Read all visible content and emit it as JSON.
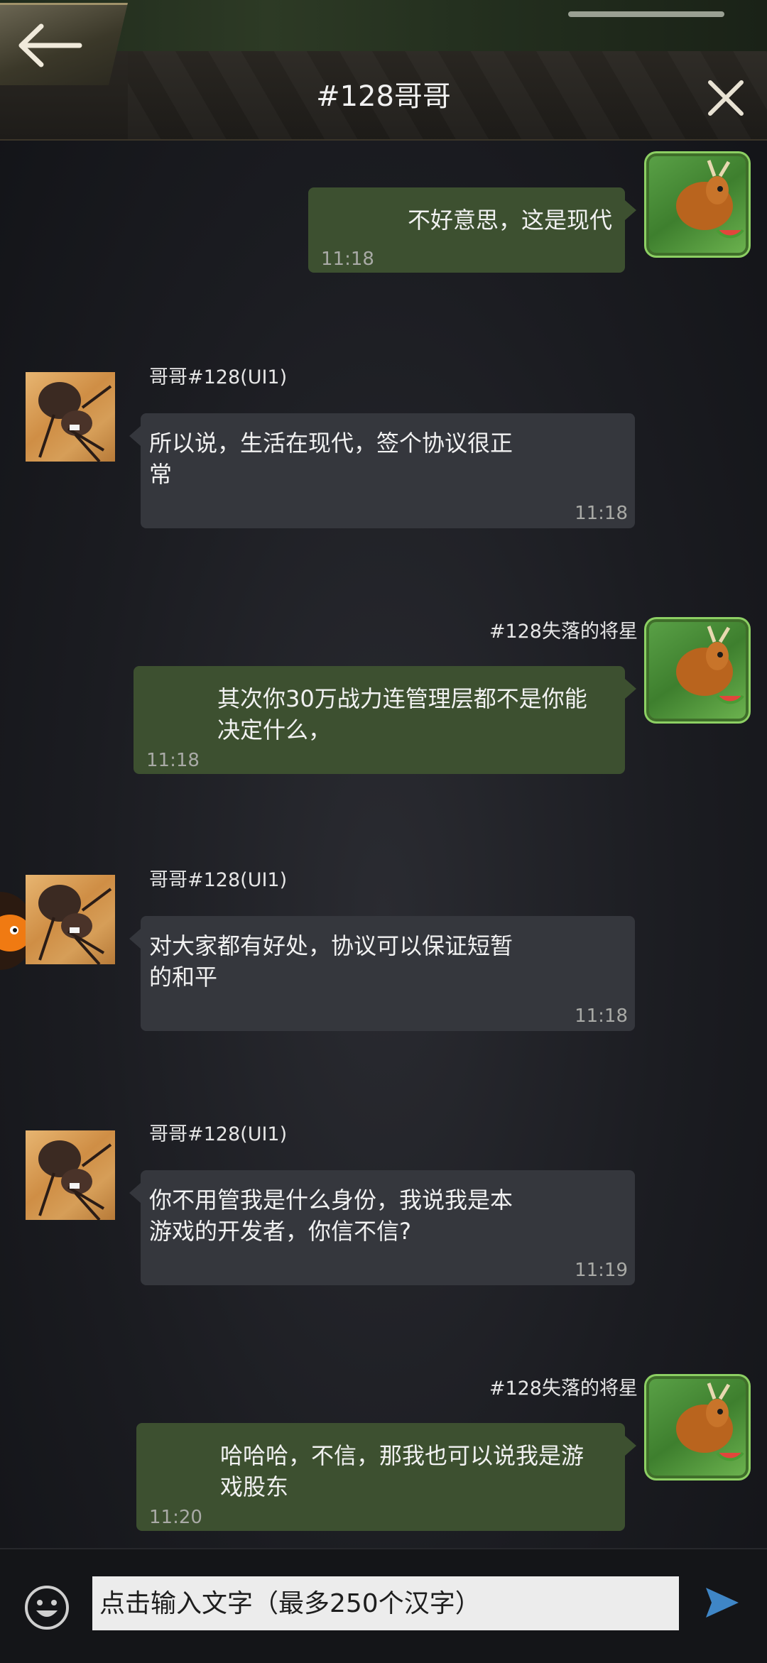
{
  "header": {
    "title": "#128哥哥"
  },
  "messages": [
    {
      "side": "right",
      "text": "不好意思，这是现代",
      "time": "11:18"
    },
    {
      "side": "left",
      "nick": "哥哥#128(UI1)",
      "text": "所以说，生活在现代，签个协议很正\n常",
      "time": "11:18"
    },
    {
      "side": "right",
      "nick": "#128失落的将星",
      "text": "其次你30万战力连管理层都不是你能\n决定什么，",
      "time": "11:18"
    },
    {
      "side": "left",
      "nick": "哥哥#128(UI1)",
      "text": "对大家都有好处，协议可以保证短暂\n的和平",
      "time": "11:18"
    },
    {
      "side": "left",
      "nick": "哥哥#128(UI1)",
      "text": "你不用管我是什么身份，我说我是本\n游戏的开发者，你信不信?",
      "time": "11:19"
    },
    {
      "side": "right",
      "nick": "#128失落的将星",
      "text": "哈哈哈，不信，那我也可以说我是游\n戏股东",
      "time": "11:20"
    }
  ],
  "input": {
    "placeholder": "点击输入文字（最多250个汉字）"
  },
  "icons": {
    "back": "back-arrow-icon",
    "close": "close-icon",
    "emoji": "emoji-icon",
    "send": "send-icon"
  },
  "colors": {
    "bubble_left": "#35373d",
    "bubble_right": "#3d5030",
    "background": "#1c1d22"
  }
}
